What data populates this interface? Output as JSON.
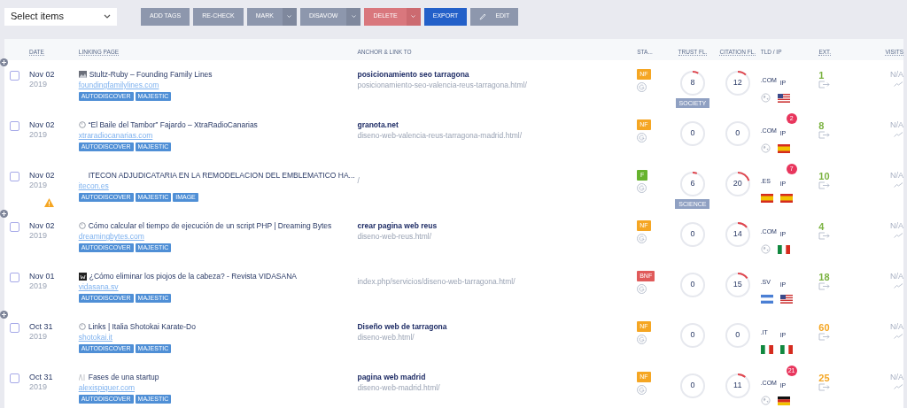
{
  "select": {
    "value": "Select items"
  },
  "toolbar": [
    {
      "label": "ADD TAGS",
      "kind": "plain",
      "disabled": true,
      "dropdown": false
    },
    {
      "label": "RE-CHECK",
      "kind": "plain",
      "disabled": true,
      "dropdown": false
    },
    {
      "label": "MARK",
      "kind": "plain",
      "disabled": true,
      "dropdown": true
    },
    {
      "label": "DISAVOW",
      "kind": "plain",
      "disabled": true,
      "dropdown": true
    },
    {
      "label": "DELETE",
      "kind": "danger",
      "disabled": true,
      "dropdown": true
    },
    {
      "label": "EXPORT",
      "kind": "primary",
      "disabled": false,
      "dropdown": false
    },
    {
      "label": "EDIT",
      "kind": "edit",
      "disabled": true,
      "dropdown": false
    }
  ],
  "columns": [
    {
      "label": "DATE",
      "sortable": true
    },
    {
      "label": "LINKING PAGE",
      "sortable": true
    },
    {
      "label": "ANCHOR & LINK TO",
      "sortable": false
    },
    {
      "label": "STA...",
      "sortable": false
    },
    {
      "label": "TRUST FL.",
      "sortable": true
    },
    {
      "label": "CITATION FL.",
      "sortable": true
    },
    {
      "label": "TLD / IP",
      "sortable": false
    },
    {
      "label": "EXT.",
      "sortable": true
    },
    {
      "label": "VISITS",
      "sortable": true
    }
  ],
  "rows": [
    {
      "expandable": true,
      "checked": false,
      "date": "Nov 02",
      "year": "2019",
      "warning": false,
      "favicon": {
        "kind": "image"
      },
      "title": "Stultz-Ruby – Founding Family Lines",
      "domain": "foundingfamilylines.com",
      "tags": [
        "AUTODISCOVER",
        "MAJESTIC"
      ],
      "anchor": "posicionamiento seo tarragona",
      "link": "posicionamiento-seo-valencia-reus-tarragona.html/",
      "status": {
        "label": "NF",
        "color": "#f5a623"
      },
      "trust": {
        "value": "8",
        "level": 0.08,
        "topic": "SOCIETY"
      },
      "citation": {
        "value": "12",
        "level": 0.12
      },
      "tld": ".COM",
      "ip_label": "IP",
      "tld_flag": {
        "kind": "globe"
      },
      "ip_flag": {
        "kind": "us"
      },
      "ext": {
        "value": "1",
        "color": "#7cb342"
      },
      "visits": "N/A"
    },
    {
      "expandable": false,
      "checked": false,
      "date": "Nov 02",
      "year": "2019",
      "warning": false,
      "favicon": {
        "kind": "globe"
      },
      "title": "“El Baile del Tambor” Fajardo – XtraRadioCanarias",
      "domain": "xtraradiocanarias.com",
      "tags": [
        "AUTODISCOVER",
        "MAJESTIC"
      ],
      "anchor": "granota.net",
      "link": "diseno-web-valencia-reus-tarragona-madrid.html/",
      "status": {
        "label": "NF",
        "color": "#f5a623"
      },
      "trust": {
        "value": "0",
        "level": 0
      },
      "citation": {
        "value": "0",
        "level": 0
      },
      "tld": ".COM",
      "ip_label": "IP",
      "ip_count": "2",
      "tld_flag": {
        "kind": "globe"
      },
      "ip_flag": {
        "kind": "es"
      },
      "ext": {
        "value": "8",
        "color": "#7cb342"
      },
      "visits": "N/A"
    },
    {
      "expandable": false,
      "checked": false,
      "date": "Nov 02",
      "year": "2019",
      "warning": true,
      "title": "ITECON ADJUDICATARIA EN LA REMODELACION DEL EMBLEMATICO HA...",
      "domain": "itecon.es",
      "tags": [
        "AUTODISCOVER",
        "MAJESTIC",
        "IMAGE"
      ],
      "link": "/",
      "status": {
        "label": "F",
        "color": "#66b32e"
      },
      "trust": {
        "value": "6",
        "level": 0.06,
        "topic": "SCIENCE"
      },
      "citation": {
        "value": "20",
        "level": 0.2
      },
      "tld": ".ES",
      "ip_label": "IP",
      "ip_count": "7",
      "tld_flag": {
        "kind": "es"
      },
      "ip_flag": {
        "kind": "es"
      },
      "ext": {
        "value": "10",
        "color": "#7cb342"
      },
      "visits": "N/A"
    },
    {
      "expandable": true,
      "checked": false,
      "date": "Nov 02",
      "year": "2019",
      "warning": false,
      "favicon": {
        "kind": "globe"
      },
      "title": "Cómo calcular el tiempo de ejecución de un script PHP | Dreaming Bytes",
      "domain": "dreamingbytes.com",
      "tags": [
        "AUTODISCOVER",
        "MAJESTIC"
      ],
      "anchor": "crear pagina web reus",
      "link": "diseno-web-reus.html/",
      "status": {
        "label": "NF",
        "color": "#f5a623"
      },
      "trust": {
        "value": "0",
        "level": 0
      },
      "citation": {
        "value": "14",
        "level": 0.14
      },
      "tld": ".COM",
      "ip_label": "IP",
      "tld_flag": {
        "kind": "globe"
      },
      "ip_flag": {
        "kind": "it"
      },
      "ext": {
        "value": "4",
        "color": "#7cb342"
      },
      "visits": "N/A"
    },
    {
      "expandable": false,
      "checked": false,
      "date": "Nov 01",
      "year": "2019",
      "warning": false,
      "favicon": {
        "kind": "dark"
      },
      "title": "¿Cómo eliminar los piojos de la cabeza? - Revista VIDASANA",
      "domain": "vidasana.sv",
      "tags": [
        "AUTODISCOVER",
        "MAJESTIC"
      ],
      "link": "index.php/servicios/diseno-web-tarragona.html/",
      "status": {
        "label": "BNF",
        "color": "#e05a5a"
      },
      "trust": {
        "value": "0",
        "level": 0
      },
      "citation": {
        "value": "15",
        "level": 0.15
      },
      "tld": ".SV",
      "ip_label": "IP",
      "tld_flag": {
        "kind": "sv"
      },
      "ip_flag": {
        "kind": "us"
      },
      "ext": {
        "value": "18",
        "color": "#7cb342"
      },
      "visits": "N/A"
    },
    {
      "expandable": true,
      "checked": false,
      "date": "Oct 31",
      "year": "2019",
      "warning": false,
      "favicon": {
        "kind": "globe"
      },
      "title": "Links | Italia Shotokai Karate-Do",
      "domain": "shotokai.it",
      "tags": [
        "AUTODISCOVER",
        "MAJESTIC"
      ],
      "anchor": "Diseño web de tarragona",
      "link": "diseno-web.html/",
      "status": {
        "label": "NF",
        "color": "#f5a623"
      },
      "trust": {
        "value": "0",
        "level": 0
      },
      "citation": {
        "value": "0",
        "level": 0
      },
      "tld": ".IT",
      "ip_label": "IP",
      "tld_flag": {
        "kind": "it"
      },
      "ip_flag": {
        "kind": "it"
      },
      "ext": {
        "value": "60",
        "color": "#f5a623"
      },
      "visits": "N/A"
    },
    {
      "expandable": false,
      "checked": false,
      "date": "Oct 31",
      "year": "2019",
      "warning": false,
      "favicon": {
        "kind": "faint"
      },
      "title": "Fases de una startup",
      "domain": "alexispiquer.com",
      "tags": [
        "AUTODISCOVER",
        "MAJESTIC"
      ],
      "anchor": "pagina web madrid",
      "link": "diseno-web-madrid.html/",
      "status": {
        "label": "NF",
        "color": "#f5a623"
      },
      "trust": {
        "value": "0",
        "level": 0
      },
      "citation": {
        "value": "11",
        "level": 0.11
      },
      "tld": ".COM",
      "ip_label": "IP",
      "ip_count": "21",
      "tld_flag": {
        "kind": "globe"
      },
      "ip_flag": {
        "kind": "de"
      },
      "ext": {
        "value": "25",
        "color": "#f5a623"
      },
      "visits": "N/A"
    }
  ]
}
